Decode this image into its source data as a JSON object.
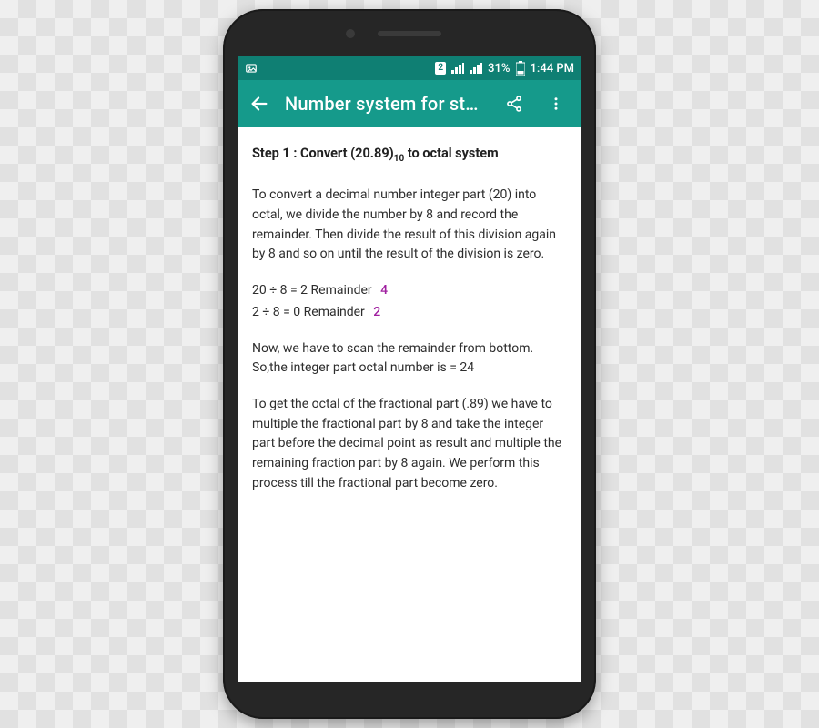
{
  "status_bar": {
    "sim_indicator": "2",
    "battery_text": "31%",
    "time": "1:44 PM"
  },
  "app_bar": {
    "title": "Number system for st…"
  },
  "content": {
    "step_heading_pre": "Step 1 : Convert (20.89)",
    "step_heading_sub": "10",
    "step_heading_post": " to octal system",
    "para1": "To convert a decimal number integer part (20) into octal, we divide the number by 8 and record the remainder. Then divide the result of this division again by 8 and so on until the result of the division is zero.",
    "calc1_expr": "20 ÷ 8 = 2  Remainder",
    "calc1_rem": "4",
    "calc2_expr": "2 ÷ 8 = 0  Remainder",
    "calc2_rem": "2",
    "para2": "Now, we have to scan the remainder from bottom. So,the integer part octal number is = 24",
    "para3": "To get the octal of the fractional part (.89) we have to multiple the fractional part by 8 and take the integer part before the decimal point as result and multiple the remaining fraction part by 8 again. We perform this process till the fractional part become zero."
  },
  "colors": {
    "status_bar_bg": "#0f7f73",
    "app_bar_bg": "#159a8b",
    "remainder_color": "#a020a0"
  }
}
